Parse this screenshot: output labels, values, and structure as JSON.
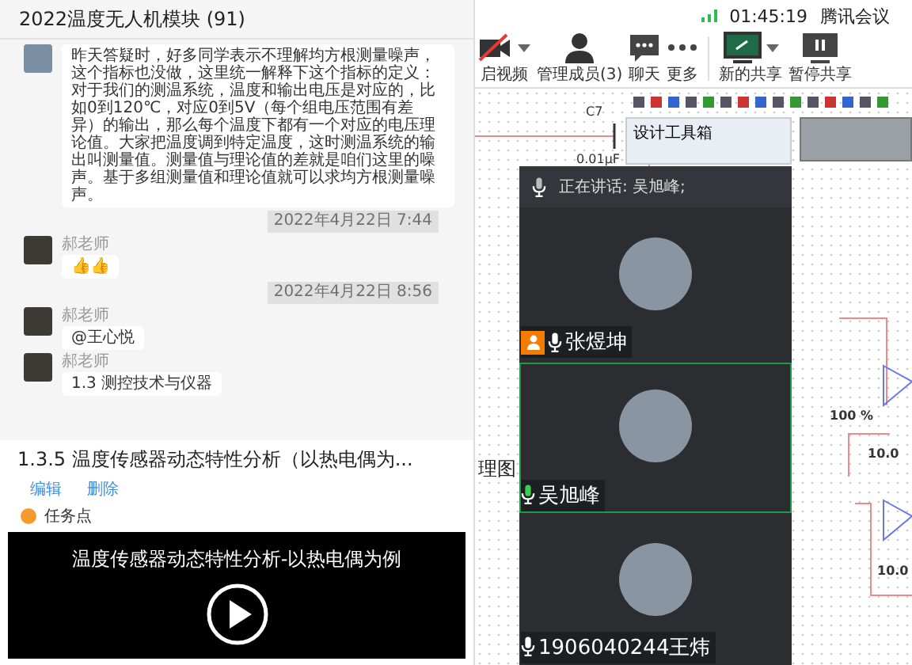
{
  "chat": {
    "title": "2022温度无人机模块 (91)",
    "items": [
      {
        "kind": "message",
        "text": "昨天答疑时，好多同学表示不理解均方根测量噪声，这个指标也没做，这里统一解释下这个指标的定义：对于我们的测温系统，温度和输出电压是对应的，比如0到120℃，对应0到5V（每个组电压范围有差异）的输出，那么每个温度下都有一个对应的电压理论值。大家把温度调到特定温度，这时测温系统的输出叫测量值。测量值与理论值的差就是咱们这里的噪声。基于多组测量值和理论值就可以求均方根测量噪声。"
      },
      {
        "kind": "time",
        "text": "2022年4月22日 7:44"
      },
      {
        "kind": "message",
        "sender": "郝老师",
        "text": "👍👍"
      },
      {
        "kind": "time",
        "text": "2022年4月22日 8:56"
      },
      {
        "kind": "message",
        "sender": "郝老师",
        "text": "@王心悦"
      },
      {
        "kind": "message",
        "sender": "郝老师",
        "text": "1.3 测控技术与仪器"
      }
    ]
  },
  "course": {
    "title": "1.3.5 温度传感器动态特性分析（以热电偶为...",
    "actions": [
      "编辑",
      "删除"
    ],
    "task_label": "任务点",
    "video_title": "温度传感器动态特性分析-以热电偶为例"
  },
  "meeting": {
    "clock": "01:45:19",
    "app_name": "腾讯会议",
    "toolbar": [
      {
        "kind": "camera",
        "label": "启视频",
        "caret": true
      },
      {
        "kind": "members",
        "label": "管理成员(3)",
        "caret": false
      },
      {
        "kind": "chat",
        "label": "聊天",
        "caret": false
      },
      {
        "kind": "more",
        "label": "更多",
        "caret": false
      },
      {
        "kind": "share",
        "label": "新的共享",
        "caret": true
      },
      {
        "kind": "pause",
        "label": "暂停共享",
        "caret": false
      }
    ],
    "schematic": {
      "capacitor_name": "C7",
      "capacitor_value": "0.01μF",
      "toolbox_title": "设计工具箱",
      "zoom": "100 %",
      "readings": [
        "10.0",
        "10.0"
      ],
      "side_label": "理图"
    },
    "speaking": "正在讲话: 吴旭峰;",
    "participants": [
      {
        "name": "张煜坤",
        "host": true,
        "speaking": false,
        "selected": false
      },
      {
        "name": "吴旭峰",
        "host": false,
        "speaking": true,
        "selected": true
      },
      {
        "name": "1906040244王炜",
        "host": false,
        "speaking": false,
        "selected": false
      }
    ]
  }
}
